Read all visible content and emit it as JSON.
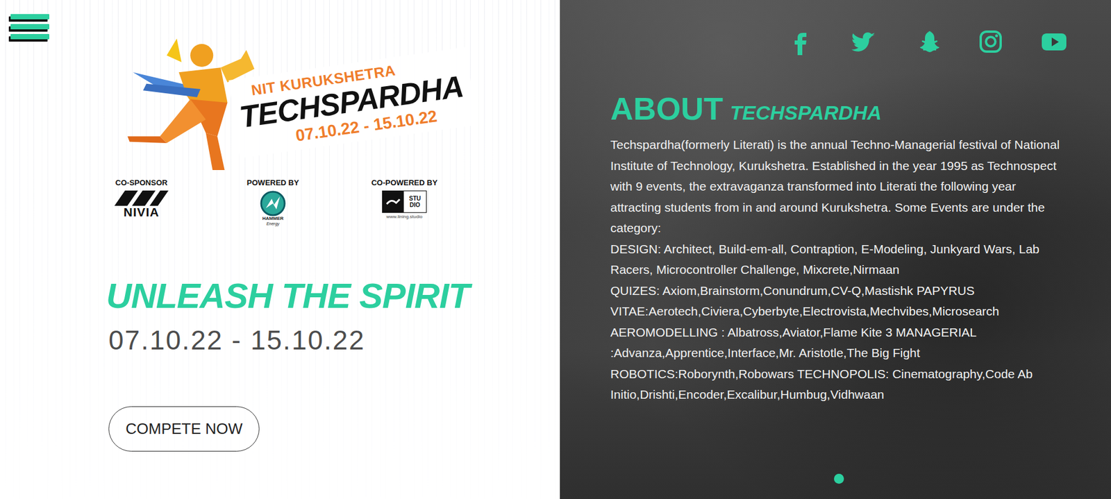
{
  "logo": {
    "subtitle": "NIT KURUKSHETRA",
    "title": "TECHSPARDHA",
    "dates": "07.10.22 - 15.10.22"
  },
  "sponsors": [
    {
      "label": "CO-SPONSOR",
      "kind": "nivia",
      "logo_text": [
        "NIVIA"
      ]
    },
    {
      "label": "POWERED BY",
      "kind": "hammer",
      "logo_text": [
        "HAMMER",
        "Energy"
      ]
    },
    {
      "label": "CO-POWERED BY",
      "kind": "lining",
      "logo_text": [
        "STU",
        "DIO",
        "www.lining.studio"
      ]
    }
  ],
  "hero": {
    "tagline": "UNLEASH THE SPIRIT",
    "dates": "07.10.22 - 15.10.22",
    "cta": "COMPETE NOW"
  },
  "about": {
    "heading": "ABOUT",
    "heading_accent": "TECHSPARDHA",
    "paragraphs": [
      "Techspardha(formerly Literati) is the annual Techno-Managerial festival of National Institute of Technology, Kurukshetra. Established in the year 1995 as Technospect with 9 events, the extravaganza transformed into Literati the following year attracting students from in and around Kurukshetra. Some Events are under the category:",
      "DESIGN: Architect, Build-em-all, Contraption, E-Modeling, Junkyard Wars, Lab Racers, Microcontroller Challenge, Mixcrete,Nirmaan",
      "QUIZES: Axiom,Brainstorm,Conundrum,CV-Q,Mastishk PAPYRUS VITAE:Aerotech,Civiera,Cyberbyte,Electrovista,Mechvibes,Microsearch AEROMODELLING : Albatross,Aviator,Flame Kite 3 MANAGERIAL :Advanza,Apprentice,Interface,Mr. Aristotle,The Big Fight ROBOTICS:Roborynth,Robowars TECHNOPOLIS: Cinematography,Code Ab Initio,Drishti,Encoder,Excalibur,Humbug,Vidhwaan"
    ]
  },
  "carousel": {
    "dots": [
      {
        "selected": true
      }
    ]
  }
}
